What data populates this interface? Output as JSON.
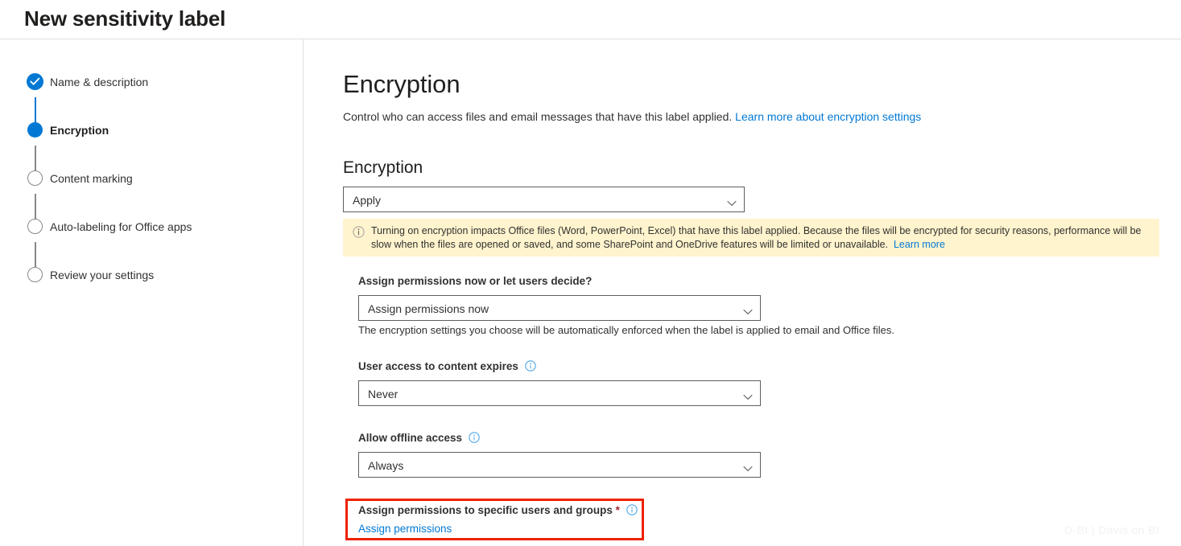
{
  "header": {
    "title": "New sensitivity label"
  },
  "sidebar": {
    "steps": [
      {
        "label": "Name & description",
        "state": "done",
        "icon": "check-circle-icon"
      },
      {
        "label": "Encryption",
        "state": "active",
        "icon": "filled-circle-icon"
      },
      {
        "label": "Content marking",
        "state": "todo",
        "icon": "empty-circle-icon"
      },
      {
        "label": "Auto-labeling for Office apps",
        "state": "todo",
        "icon": "empty-circle-icon"
      },
      {
        "label": "Review your settings",
        "state": "todo",
        "icon": "empty-circle-icon"
      }
    ]
  },
  "main": {
    "title": "Encryption",
    "description": "Control who can access files and email messages that have this label applied.",
    "description_link": "Learn more about encryption settings",
    "encryption_subhead": "Encryption",
    "encryption_dropdown": {
      "value": "Apply",
      "chevron": "chevron-down-icon"
    },
    "banner": {
      "icon": "info-circle-icon",
      "text": "Turning on encryption impacts Office files (Word, PowerPoint, Excel) that have this label applied. Because the files will be encrypted for security reasons, performance will be slow when the files are opened or saved, and some SharePoint and OneDrive features will be limited or unavailable.",
      "link": "Learn more"
    },
    "fields": [
      {
        "label": "Assign permissions now or let users decide?",
        "value": "Assign permissions now",
        "help": "The encryption settings you choose will be automatically enforced when the label is applied to email and Office files.",
        "info": false
      },
      {
        "label": "User access to content expires",
        "value": "Never",
        "help": "",
        "info": true
      },
      {
        "label": "Allow offline access",
        "value": "Always",
        "help": "",
        "info": true
      }
    ],
    "assign_permissions": {
      "label": "Assign permissions to specific users and groups",
      "required_marker": "*",
      "info": "info-circle-icon",
      "link": "Assign permissions",
      "highlight_color": "#ee2200"
    }
  },
  "watermark": {
    "text": "D-BI | Davis on BI"
  },
  "colors": {
    "accent": "#0078d4",
    "banner_bg": "#fff4ce",
    "highlight": "#ee2200",
    "required": "#a4262c"
  }
}
